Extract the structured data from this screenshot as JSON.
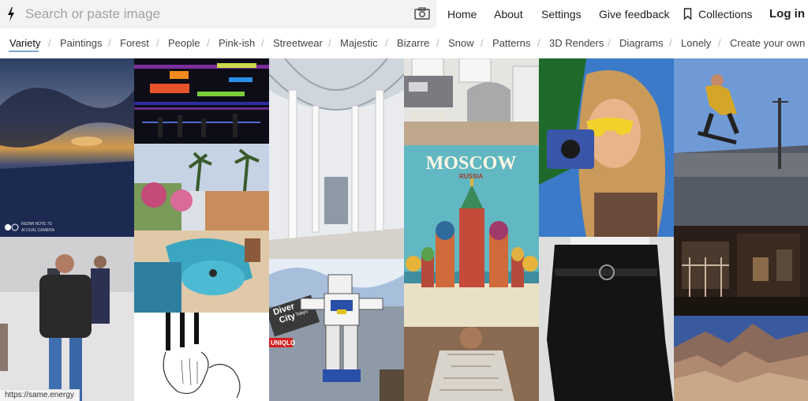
{
  "search": {
    "placeholder": "Search or paste image"
  },
  "nav": {
    "home": "Home",
    "about": "About",
    "settings": "Settings",
    "feedback": "Give feedback",
    "collections": "Collections",
    "login": "Log in"
  },
  "tabs": [
    {
      "label": "Variety",
      "active": true
    },
    {
      "label": "Paintings"
    },
    {
      "label": "Forest"
    },
    {
      "label": "People"
    },
    {
      "label": "Pink-ish"
    },
    {
      "label": "Streetwear"
    },
    {
      "label": "Majestic"
    },
    {
      "label": "Bizarre"
    },
    {
      "label": "Snow"
    },
    {
      "label": "Patterns"
    },
    {
      "label": "3D Renders"
    },
    {
      "label": "Diagrams"
    },
    {
      "label": "Lonely"
    },
    {
      "label": "Create your own"
    }
  ],
  "separator": "/",
  "images": {
    "sunset_watermark_line1": "REDMI NOTE 7S",
    "sunset_watermark_line2": "AI DUAL CAMERA",
    "poster_title": "MOSCOW",
    "poster_subtitle": "RUSSIA",
    "gundam_sign_line1": "Diver",
    "gundam_sign_line2": "City",
    "gundam_sign_line3": "Tokyo",
    "gundam_brand": "UNIQLO"
  },
  "status_bar": {
    "url": "https://same.energy"
  },
  "icons": {
    "logo": "bolt-icon",
    "camera": "camera-icon",
    "bookmark": "bookmark-icon"
  }
}
